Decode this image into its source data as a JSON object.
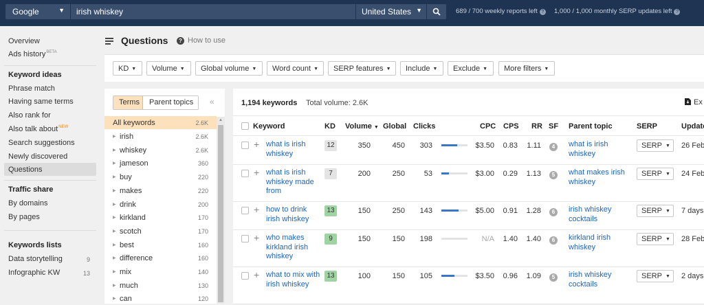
{
  "topbar": {
    "engine": "Google",
    "query": "irish whiskey",
    "country": "United States",
    "weekly_reports": "689 / 700 weekly reports left",
    "monthly_updates": "1,000 / 1,000 monthly SERP updates left"
  },
  "sidebar": {
    "overview": "Overview",
    "ads_history": "Ads history",
    "ads_badge": "BETA",
    "section_ideas": "Keyword ideas",
    "phrase_match": "Phrase match",
    "same_terms": "Having same terms",
    "also_rank": "Also rank for",
    "also_talk": "Also talk about",
    "new_badge": "NEW",
    "suggestions": "Search suggestions",
    "newly": "Newly discovered",
    "questions": "Questions",
    "section_traffic": "Traffic share",
    "by_domains": "By domains",
    "by_pages": "By pages",
    "section_lists": "Keywords lists",
    "list1_name": "Data storytelling",
    "list1_count": "9",
    "list2_name": "Infographic KW",
    "list2_count": "13"
  },
  "header": {
    "title": "Questions",
    "how_to_use": "How to use"
  },
  "filters": {
    "kd": "KD",
    "volume": "Volume",
    "global_volume": "Global volume",
    "word_count": "Word count",
    "serp_features": "SERP features",
    "include": "Include",
    "exclude": "Exclude",
    "more_filters": "More filters"
  },
  "terms_panel": {
    "tab_terms": "Terms",
    "tab_parent": "Parent topics",
    "collapse": "«",
    "all_label": "All keywords",
    "all_count": "2.6K",
    "terms": [
      {
        "label": "irish",
        "count": "2.6K"
      },
      {
        "label": "whiskey",
        "count": "2.6K"
      },
      {
        "label": "jameson",
        "count": "360"
      },
      {
        "label": "buy",
        "count": "220"
      },
      {
        "label": "makes",
        "count": "220"
      },
      {
        "label": "drink",
        "count": "200"
      },
      {
        "label": "kirkland",
        "count": "170"
      },
      {
        "label": "scotch",
        "count": "170"
      },
      {
        "label": "best",
        "count": "160"
      },
      {
        "label": "difference",
        "count": "160"
      },
      {
        "label": "mix",
        "count": "140"
      },
      {
        "label": "much",
        "count": "130"
      },
      {
        "label": "can",
        "count": "120"
      }
    ]
  },
  "results": {
    "keyword_count": "1,194 keywords",
    "total_volume": "Total volume: 2.6K",
    "export_label": "Ex",
    "columns": {
      "keyword": "Keyword",
      "kd": "KD",
      "volume": "Volume",
      "global": "Global",
      "clicks": "Clicks",
      "cpc": "CPC",
      "cps": "CPS",
      "rr": "RR",
      "sf": "SF",
      "parent_topic": "Parent topic",
      "serp": "SERP",
      "update": "Update"
    },
    "rows": [
      {
        "keyword": "what is irish whiskey",
        "kd": "12",
        "volume": "350",
        "global": "450",
        "clicks": "303",
        "paid_share": 0.6,
        "cpc": "$3.50",
        "cps": "0.83",
        "rr": "1.11",
        "sf": "4",
        "parent_topic": "what is irish whiskey",
        "serp": "SERP",
        "updated": "26 Feb"
      },
      {
        "keyword": "what is irish whiskey made from",
        "kd": "7",
        "volume": "200",
        "global": "250",
        "clicks": "53",
        "paid_share": 0.3,
        "cpc": "$3.00",
        "cps": "0.29",
        "rr": "1.13",
        "sf": "5",
        "parent_topic": "what makes irish whiskey",
        "serp": "SERP",
        "updated": "24 Feb"
      },
      {
        "keyword": "how to drink irish whiskey",
        "kd": "13",
        "volume": "150",
        "global": "250",
        "clicks": "143",
        "paid_share": 0.65,
        "cpc": "$5.00",
        "cps": "0.91",
        "rr": "1.28",
        "sf": "6",
        "parent_topic": "irish whiskey cocktails",
        "serp": "SERP",
        "updated": "7 days"
      },
      {
        "keyword": "who makes kirkland irish whiskey",
        "kd": "9",
        "volume": "150",
        "global": "150",
        "clicks": "198",
        "paid_share": 0,
        "cpc": "N/A",
        "cps": "1.40",
        "rr": "1.40",
        "sf": "6",
        "parent_topic": "kirkland irish whiskey",
        "serp": "SERP",
        "updated": "28 Feb"
      },
      {
        "keyword": "what to mix with irish whiskey",
        "kd": "13",
        "volume": "100",
        "global": "150",
        "clicks": "105",
        "paid_share": 0.5,
        "cpc": "$3.50",
        "cps": "0.96",
        "rr": "1.09",
        "sf": "5",
        "parent_topic": "irish whiskey cocktails",
        "serp": "SERP",
        "updated": "2 days"
      }
    ]
  },
  "colors": {
    "topbar": "#1f3352",
    "kd_easy": "#9fd3a1",
    "kd_neutral": "#e4e4e4",
    "link": "#1a66c4",
    "selected": "#fde1bd"
  }
}
